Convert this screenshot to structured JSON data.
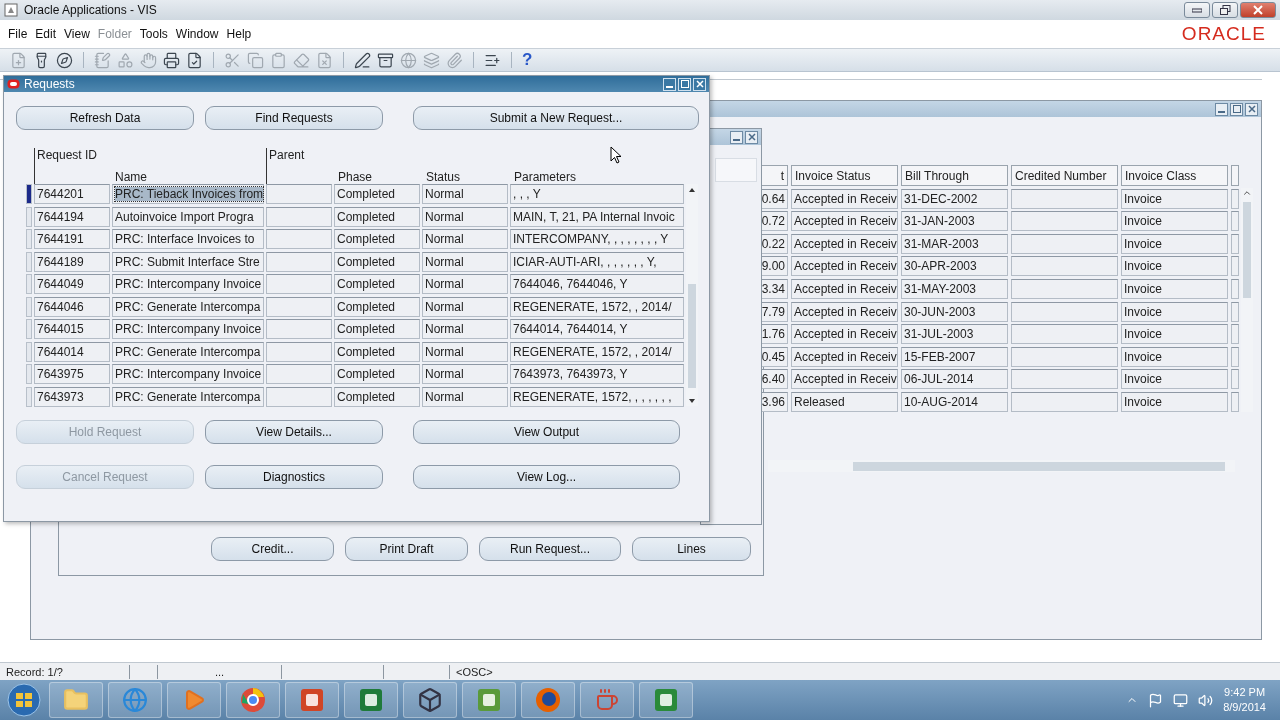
{
  "app_window": {
    "title": "Oracle Applications - VIS"
  },
  "menu": [
    {
      "label": "File",
      "disabled": false
    },
    {
      "label": "Edit",
      "disabled": false
    },
    {
      "label": "View",
      "disabled": false
    },
    {
      "label": "Folder",
      "disabled": true
    },
    {
      "label": "Tools",
      "disabled": false
    },
    {
      "label": "Window",
      "disabled": false
    },
    {
      "label": "Help",
      "disabled": false
    }
  ],
  "logo_text": "ORACLE",
  "toolbar": {
    "help_glyph": "?"
  },
  "invoice_window": {
    "columns": [
      "t",
      "Invoice Status",
      "Bill Through",
      "Credited Number",
      "Invoice Class"
    ],
    "rows": [
      {
        "column_1": "0.64",
        "invoice_status": "Accepted in Receiv",
        "bill_through": "31-DEC-2002",
        "invoice_class": "Invoice"
      },
      {
        "column_1": "0.72",
        "invoice_status": "Accepted in Receiv",
        "bill_through": "31-JAN-2003",
        "invoice_class": "Invoice"
      },
      {
        "column_1": "0.22",
        "invoice_status": "Accepted in Receiv",
        "bill_through": "31-MAR-2003",
        "invoice_class": "Invoice"
      },
      {
        "column_1": "9.00",
        "invoice_status": "Accepted in Receiv",
        "bill_through": "30-APR-2003",
        "invoice_class": "Invoice"
      },
      {
        "column_1": "3.34",
        "invoice_status": "Accepted in Receiv",
        "bill_through": "31-MAY-2003",
        "invoice_class": "Invoice"
      },
      {
        "column_1": "7.79",
        "invoice_status": "Accepted in Receiv",
        "bill_through": "30-JUN-2003",
        "invoice_class": "Invoice"
      },
      {
        "column_1": "1.76",
        "invoice_status": "Accepted in Receiv",
        "bill_through": "31-JUL-2003",
        "invoice_class": "Invoice"
      },
      {
        "column_1": "0.45",
        "invoice_status": "Accepted in Receiv",
        "bill_through": "15-FEB-2007",
        "invoice_class": "Invoice"
      },
      {
        "column_1": "6.40",
        "invoice_status": "Accepted in Receiv",
        "bill_through": "06-JUL-2014",
        "invoice_class": "Invoice"
      },
      {
        "column_1": "3.96",
        "invoice_status": "Released",
        "bill_through": "10-AUG-2014",
        "invoice_class": "Invoice"
      }
    ],
    "buttons": [
      {
        "label": "Credit..."
      },
      {
        "label": "Print Draft"
      },
      {
        "label": "Run Request..."
      },
      {
        "label": "Lines"
      }
    ]
  },
  "requests_window": {
    "title": "Requests",
    "top_buttons": [
      {
        "label": "Refresh Data"
      },
      {
        "label": "Find Requests"
      },
      {
        "label": "Submit a New Request..."
      }
    ],
    "columns": {
      "request_id": "Request ID",
      "parent": "Parent",
      "name": "Name",
      "phase": "Phase",
      "status": "Status",
      "parameters": "Parameters"
    },
    "rows": [
      {
        "request_id": "7644201",
        "name": "PRC: Tieback Invoices from",
        "phase": "Completed",
        "status": "Normal",
        "parameters": ", , , Y",
        "selected": true
      },
      {
        "request_id": "7644194",
        "name": "Autoinvoice Import Progra",
        "phase": "Completed",
        "status": "Normal",
        "parameters": "MAIN, T, 21, PA Internal Invoic",
        "selected": false
      },
      {
        "request_id": "7644191",
        "name": "PRC: Interface Invoices to",
        "phase": "Completed",
        "status": "Normal",
        "parameters": "INTERCOMPANY, , , , , , , , Y",
        "selected": false
      },
      {
        "request_id": "7644189",
        "name": "PRC: Submit Interface Stre",
        "phase": "Completed",
        "status": "Normal",
        "parameters": "ICIAR-AUTI-ARI, , , , , , , Y,",
        "selected": false
      },
      {
        "request_id": "7644049",
        "name": "PRC: Intercompany Invoice",
        "phase": "Completed",
        "status": "Normal",
        "parameters": "7644046, 7644046, Y",
        "selected": false
      },
      {
        "request_id": "7644046",
        "name": "PRC: Generate Intercompa",
        "phase": "Completed",
        "status": "Normal",
        "parameters": "REGENERATE, 1572, , 2014/",
        "selected": false
      },
      {
        "request_id": "7644015",
        "name": "PRC: Intercompany Invoice",
        "phase": "Completed",
        "status": "Normal",
        "parameters": "7644014, 7644014, Y",
        "selected": false
      },
      {
        "request_id": "7644014",
        "name": "PRC: Generate Intercompa",
        "phase": "Completed",
        "status": "Normal",
        "parameters": "REGENERATE, 1572, , 2014/",
        "selected": false
      },
      {
        "request_id": "7643975",
        "name": "PRC: Intercompany Invoice",
        "phase": "Completed",
        "status": "Normal",
        "parameters": "7643973, 7643973, Y",
        "selected": false
      },
      {
        "request_id": "7643973",
        "name": "PRC: Generate Intercompa",
        "phase": "Completed",
        "status": "Normal",
        "parameters": "REGENERATE, 1572, , , , , , ,",
        "selected": false
      }
    ],
    "buttons": [
      {
        "label": "Hold Request",
        "disabled": true
      },
      {
        "label": "View Details...",
        "disabled": false
      },
      {
        "label": "View Output",
        "disabled": false
      },
      {
        "label": "Cancel Request",
        "disabled": true
      },
      {
        "label": "Diagnostics",
        "disabled": false
      },
      {
        "label": "View Log...",
        "disabled": false
      }
    ]
  },
  "status_bar": {
    "record": "Record: 1/?",
    "field_3": "...",
    "mode": "<OSC>"
  },
  "taskbar": {
    "time": "9:42 PM",
    "date": "8/9/2014"
  }
}
